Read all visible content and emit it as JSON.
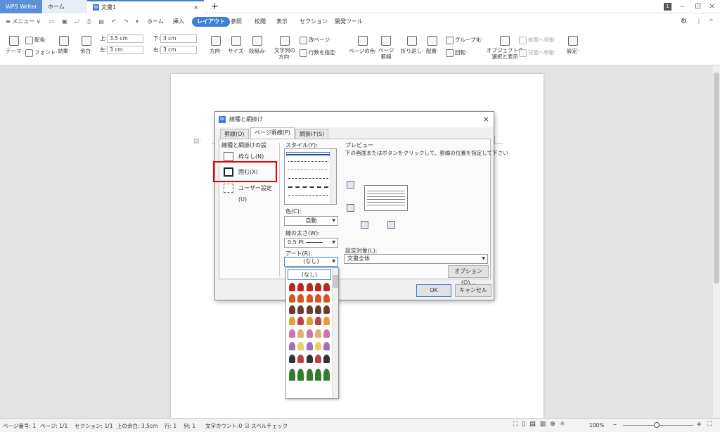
{
  "titlebar": {
    "app_tab": "WPS Writer",
    "home_tab": "ホーム",
    "doc_tab": "文書1",
    "doc_icon": "W",
    "new_tab": "+",
    "tab_close": "×",
    "badge": "1",
    "minimize": "–",
    "restore": "⊡",
    "close": "×"
  },
  "menubar": {
    "menu": "≡ メニュー ∨",
    "items": [
      "ホーム",
      "挿入",
      "レイアウト",
      "参照",
      "校閲",
      "表示",
      "セクション",
      "開発ツール"
    ],
    "gear": "⚙",
    "more": "⋮",
    "expand": "^"
  },
  "ribbon": {
    "theme": "テーマ·",
    "colors": "配色·",
    "fonts": "フォント·",
    "effects": "効果·",
    "margin": "余白·",
    "top_label": "上:",
    "top_value": "3.5 cm",
    "bottom_label": "下:",
    "bottom_value": "3 cm",
    "left_label": "左:",
    "left_value": "3 cm",
    "right_label": "右:",
    "right_value": "3 cm",
    "orientation": "方向·",
    "size": "サイズ·",
    "columns": "段組み·",
    "text_direction": "文字列の\n方向·",
    "page_break": "改ページ·",
    "line_numbers": "行数を指定·",
    "page_color": "ページの色·",
    "page_border": "ページ\n罫線",
    "wrap": "折り返し·",
    "align": "配置·",
    "group": "グループ化·",
    "rotate": "回転·",
    "selection_pane": "オブジェクトの\n選択と表示",
    "bring_forward": "前面へ移動·",
    "send_backward": "背面へ移動·",
    "settings": "設定·"
  },
  "dialog": {
    "icon": "W",
    "title": "線種と網掛け",
    "close": "×",
    "tabs": [
      "罫線(O)",
      "ページ罫線(P)",
      "網掛け(S)"
    ],
    "setting_label": "線種と網掛けの設",
    "settings": [
      "枠なし(N)",
      "囲む(X)",
      "ユーザー設定(U)"
    ],
    "style_label": "スタイル(Y):",
    "color_label": "色(C):",
    "color_value": "自動",
    "width_label": "線の太さ(W):",
    "width_value": "0.5  Pt",
    "art_label": "アート(R):",
    "art_value": "(なし)",
    "art_first_option": "(なし)",
    "preview_label": "プレビュー",
    "preview_hint": "下の画面またはボタンをクリックして、罫線の位置を指定して下さい",
    "apply_label": "設定対象(L):",
    "apply_value": "文書全体",
    "options_button": "オプション(O)...",
    "ok_button": "OK",
    "cancel_button": "キャンセル"
  },
  "status": {
    "page_no": "ページ番号: 1",
    "pages": "ページ: 1/1",
    "section": "セクション: 1/1",
    "top_margin": "上の余白: 3.5cm",
    "row": "行: 1",
    "col": "列: 1",
    "word_count": "文字カウント:0",
    "spell": "スペルチェック",
    "zoom": "100%",
    "zoom_minus": "–",
    "zoom_plus": "+"
  },
  "colors": {
    "accent": "#3c7fd6",
    "highlight": "#e00000"
  }
}
